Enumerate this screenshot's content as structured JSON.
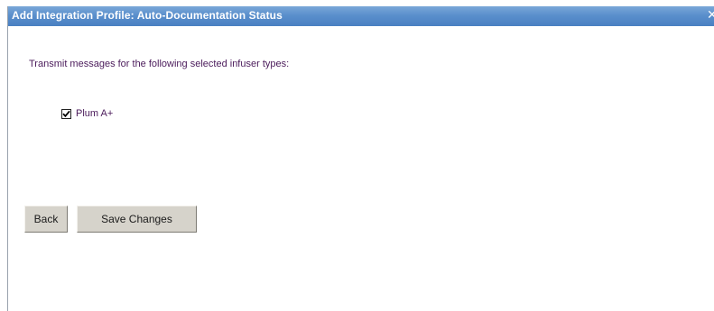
{
  "dialog": {
    "title": "Add Integration Profile: Auto-Documentation Status",
    "close_glyph": "✕"
  },
  "main": {
    "instruction": "Transmit messages for the following selected infuser types:",
    "infuser_types": [
      {
        "label": "Plum A+",
        "checked": true
      }
    ]
  },
  "buttons": {
    "back_label": "Back",
    "save_label": "Save Changes"
  },
  "colors": {
    "titlebar": "#5a8fcc",
    "text": "#4a1a5a",
    "button_face": "#d6d3cb"
  }
}
